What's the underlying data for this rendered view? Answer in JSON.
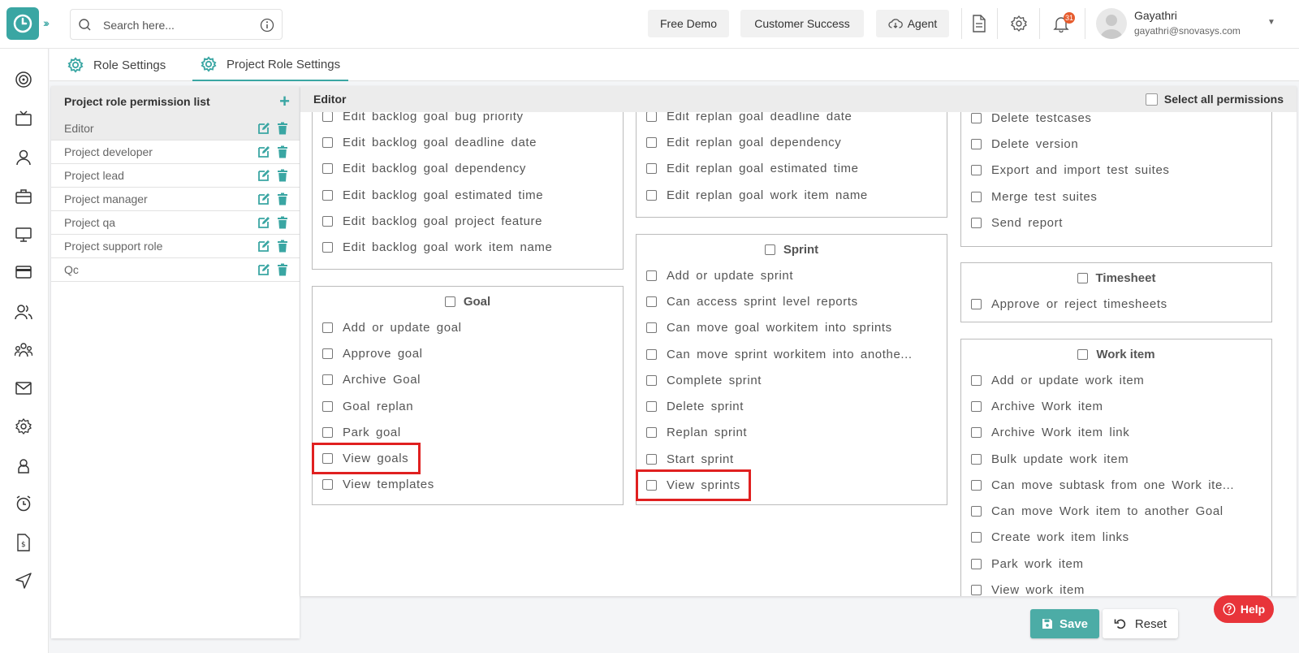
{
  "search": {
    "placeholder": "Search here..."
  },
  "topbar": {
    "free_demo": "Free Demo",
    "customer_success": "Customer Success",
    "agent": "Agent",
    "notification_count": "31",
    "user_name": "Gayathri",
    "user_email": "gayathri@snovasys.com"
  },
  "tabs": [
    {
      "label": "Role Settings"
    },
    {
      "label": "Project Role Settings"
    }
  ],
  "role_list": {
    "title": "Project role permission list",
    "items": [
      {
        "label": "Editor"
      },
      {
        "label": "Project developer"
      },
      {
        "label": "Project lead"
      },
      {
        "label": "Project manager"
      },
      {
        "label": "Project qa"
      },
      {
        "label": "Project support role"
      },
      {
        "label": "Qc"
      }
    ]
  },
  "editor": {
    "title": "Editor",
    "select_all": "Select all permissions",
    "col1": {
      "backlog_items": [
        "Edit backlog goal bug priority",
        "Edit backlog goal deadline date",
        "Edit backlog goal dependency",
        "Edit backlog goal estimated time",
        "Edit backlog goal project feature",
        "Edit backlog goal work item name"
      ],
      "goal": {
        "title": "Goal",
        "items": [
          "Add or update goal",
          "Approve goal",
          "Archive Goal",
          "Goal replan",
          "Park goal",
          "View goals",
          "View templates"
        ]
      }
    },
    "col2": {
      "replan_items": [
        "Edit replan goal deadline date",
        "Edit replan goal dependency",
        "Edit replan goal estimated time",
        "Edit replan goal work item name"
      ],
      "sprint": {
        "title": "Sprint",
        "items": [
          "Add or update sprint",
          "Can access sprint level reports",
          "Can move goal workitem into sprints",
          "Can move sprint workitem into anothe...",
          "Complete sprint",
          "Delete sprint",
          "Replan sprint",
          "Start sprint",
          "View sprints"
        ]
      }
    },
    "col3": {
      "test_items": [
        "Delete testcases",
        "Delete version",
        "Export and import test suites",
        "Merge test suites",
        "Send report"
      ],
      "timesheet": {
        "title": "Timesheet",
        "items": [
          "Approve or reject timesheets"
        ]
      },
      "work_item": {
        "title": "Work item",
        "items": [
          "Add or update work item",
          "Archive Work item",
          "Archive Work item link",
          "Bulk update work item",
          "Can move subtask from one Work ite...",
          "Can move Work item to another Goal",
          "Create work item links",
          "Park work item",
          "View work item"
        ]
      }
    }
  },
  "buttons": {
    "save": "Save",
    "reset": "Reset",
    "help": "Help"
  },
  "colors": {
    "accent": "#3aa6a3",
    "highlight": "#e02020",
    "help": "#e8343a",
    "badge": "#e65c2e"
  }
}
